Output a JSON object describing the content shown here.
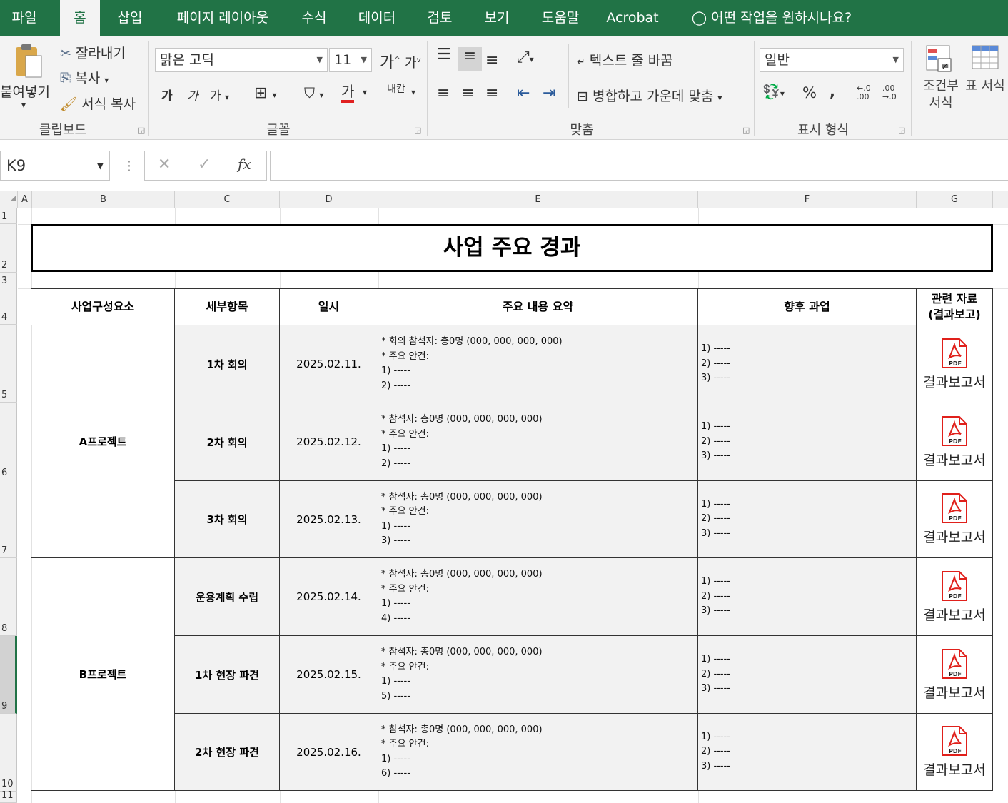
{
  "ribbon": {
    "tabs": [
      "파일",
      "홈",
      "삽입",
      "페이지 레이아웃",
      "수식",
      "데이터",
      "검토",
      "보기",
      "도움말",
      "Acrobat"
    ],
    "tell_me": "어떤 작업을 원하시나요?",
    "clipboard": {
      "paste": "붙여넣기",
      "cut": "잘라내기",
      "copy": "복사",
      "format_painter": "서식 복사",
      "label": "클립보드"
    },
    "font": {
      "name": "맑은 고딕",
      "size": "11",
      "label": "글꼴",
      "grow": "가",
      "shrink": "가",
      "bold": "가",
      "italic": "가",
      "underline": "가",
      "color_a": "가"
    },
    "align": {
      "wrap": "텍스트 줄 바꿈",
      "merge": "병합하고 가운데 맞춤",
      "label": "맞춤",
      "vertical": "내칸"
    },
    "number": {
      "format": "일반",
      "label": "표시 형식",
      "percent": "%",
      "comma": ",",
      "inc": "←.0 .00",
      "dec": ".00 →.0"
    },
    "styles": {
      "conditional": "조건부 서식",
      "table": "표 서식"
    }
  },
  "formula_bar": {
    "name_box": "K9",
    "fx": "fx",
    "value": ""
  },
  "columns": [
    "A",
    "B",
    "C",
    "D",
    "E",
    "F",
    "G"
  ],
  "rows": [
    "1",
    "2",
    "3",
    "4",
    "5",
    "6",
    "7",
    "8",
    "9",
    "10",
    "11"
  ],
  "sheet": {
    "title": "사업 주요 경과",
    "headers": [
      "사업구성요소",
      "세부항목",
      "일시",
      "주요 내용 요약",
      "향후 과업",
      "관련 자료\n(결과보고)"
    ],
    "groups": [
      "A프로젝트",
      "B프로젝트"
    ],
    "items": [
      {
        "sub": "1차 회의",
        "date": "2025.02.11.",
        "summary": "* 회의 참석자: 총0명 (000, 000, 000, 000)\n* 주요 안건:\n1) -----\n2) -----",
        "future": "1) -----\n2) -----\n3) -----",
        "doc": "결과보고서"
      },
      {
        "sub": "2차 회의",
        "date": "2025.02.12.",
        "summary": "* 참석자: 총0명 (000, 000, 000, 000)\n* 주요 안건:\n1) -----\n2) -----",
        "future": "1) -----\n2) -----\n3) -----",
        "doc": "결과보고서"
      },
      {
        "sub": "3차 회의",
        "date": "2025.02.13.",
        "summary": "* 참석자: 총0명 (000, 000, 000, 000)\n* 주요 안건:\n1) -----\n3) -----",
        "future": "1) -----\n2) -----\n3) -----",
        "doc": "결과보고서"
      },
      {
        "sub": "운용계획 수립",
        "date": "2025.02.14.",
        "summary": "* 참석자: 총0명 (000, 000, 000, 000)\n* 주요 안건:\n1) -----\n4) -----",
        "future": "1) -----\n2) -----\n3) -----",
        "doc": "결과보고서"
      },
      {
        "sub": "1차 현장 파견",
        "date": "2025.02.15.",
        "summary": "* 참석자: 총0명 (000, 000, 000, 000)\n* 주요 안건:\n1) -----\n5) -----",
        "future": "1) -----\n2) -----\n3) -----",
        "doc": "결과보고서"
      },
      {
        "sub": "2차 현장 파견",
        "date": "2025.02.16.",
        "summary": "* 참석자: 총0명 (000, 000, 000, 000)\n* 주요 안건:\n1) -----\n6) -----",
        "future": "1) -----\n2) -----\n3) -----",
        "doc": "결과보고서"
      }
    ]
  },
  "colors": {
    "excel_green": "#217346",
    "pdf_red": "#e0201b"
  }
}
